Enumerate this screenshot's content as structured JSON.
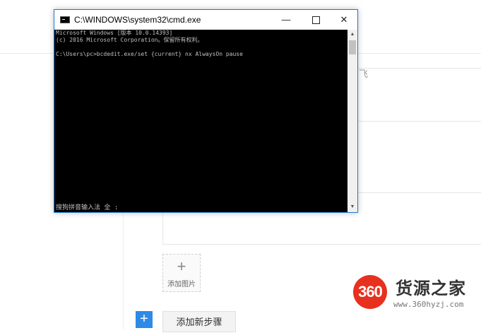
{
  "background_page": {
    "add_image_label": "添加图片",
    "add_step_label": "添加新步骤",
    "plus_symbol": "+",
    "field_glyph": "飞"
  },
  "watermark": {
    "badge": "360",
    "title": "货源之家",
    "url": "www.360hyzj.com"
  },
  "cmd": {
    "title": "C:\\WINDOWS\\system32\\cmd.exe",
    "lines": [
      "Microsoft Windows [版本 10.0.14393]",
      "(c) 2016 Microsoft Corporation。保留所有权利。",
      "C:\\Users\\pc>bcdedit.exe/set {current} nx AlwaysOn pause"
    ],
    "ime_status": "搜狗拼音输入法 全 :"
  },
  "colors": {
    "accent_blue": "#2f8ae5",
    "watermark_red": "#e8301e",
    "console_bg": "#000000",
    "console_text": "#c0c0c0"
  }
}
